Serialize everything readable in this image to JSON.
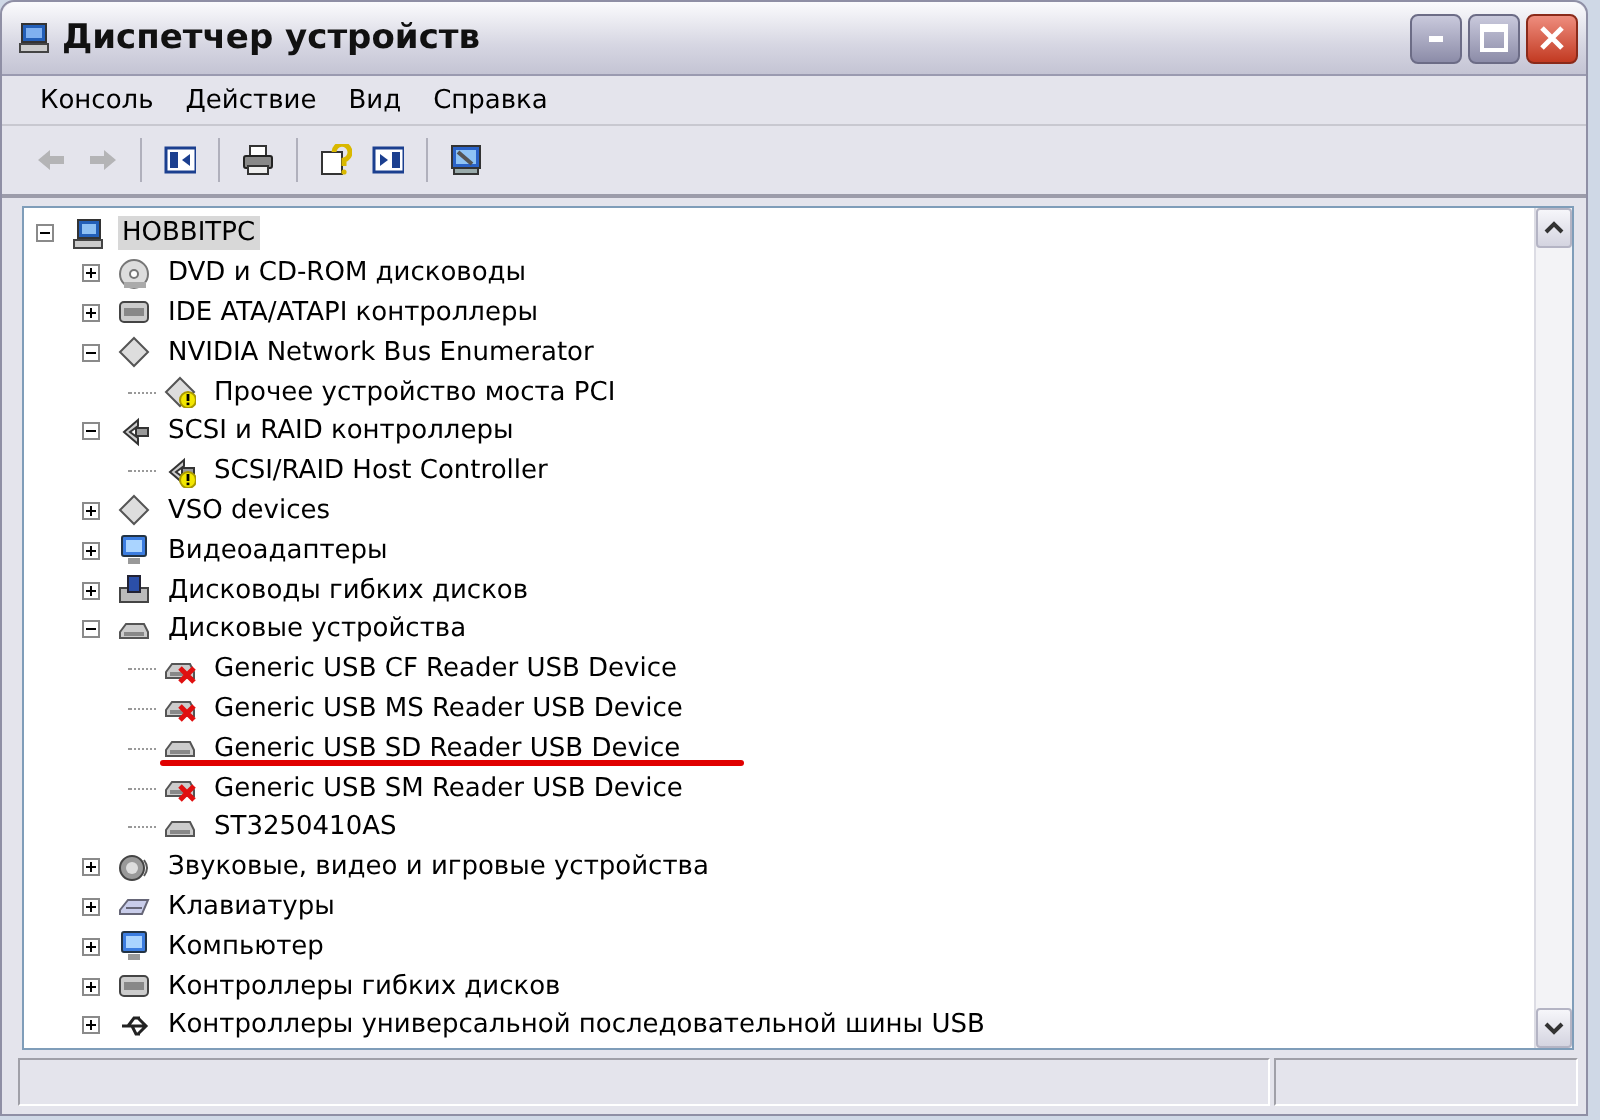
{
  "window": {
    "title": "Диспетчер устройств"
  },
  "menu": [
    "Консоль",
    "Действие",
    "Вид",
    "Справка"
  ],
  "toolbar": [
    [
      {
        "kind": "back",
        "disabled": true
      },
      {
        "kind": "forward",
        "disabled": true
      }
    ],
    [
      {
        "kind": "tree-pane",
        "disabled": false
      }
    ],
    [
      {
        "kind": "print",
        "disabled": false
      }
    ],
    [
      {
        "kind": "help",
        "disabled": false
      },
      {
        "kind": "pane",
        "disabled": false
      }
    ],
    [
      {
        "kind": "properties",
        "disabled": false
      }
    ]
  ],
  "tree": {
    "label": "HOBBITPC",
    "kind": "computer",
    "selected": true,
    "expanded": true,
    "children": [
      {
        "label": "DVD и CD-ROM дисководы",
        "kind": "cdrom",
        "expanded": false
      },
      {
        "label": "IDE ATA/ATAPI контроллеры",
        "kind": "controller",
        "expanded": false
      },
      {
        "label": "NVIDIA Network Bus Enumerator",
        "kind": "generic",
        "expanded": true,
        "children": [
          {
            "label": "Прочее устройство моста PCI",
            "kind": "generic",
            "warning": true,
            "error": false,
            "underlined": false
          }
        ]
      },
      {
        "label": "SCSI и RAID контроллеры",
        "kind": "scsi",
        "expanded": true,
        "children": [
          {
            "label": "SCSI/RAID Host Controller",
            "kind": "scsi",
            "warning": true,
            "error": false,
            "underlined": false
          }
        ]
      },
      {
        "label": "VSO devices",
        "kind": "generic",
        "expanded": false
      },
      {
        "label": "Видеоадаптеры",
        "kind": "display",
        "expanded": false
      },
      {
        "label": "Дисководы гибких дисков",
        "kind": "floppy",
        "expanded": false
      },
      {
        "label": "Дисковые устройства",
        "kind": "disk",
        "expanded": true,
        "children": [
          {
            "label": "Generic USB CF Reader USB Device",
            "kind": "disk",
            "warning": false,
            "error": true,
            "underlined": false
          },
          {
            "label": "Generic USB MS Reader USB Device",
            "kind": "disk",
            "warning": false,
            "error": true,
            "underlined": false
          },
          {
            "label": "Generic USB SD Reader USB Device",
            "kind": "disk",
            "warning": false,
            "error": false,
            "underlined": true
          },
          {
            "label": "Generic USB SM Reader USB Device",
            "kind": "disk",
            "warning": false,
            "error": true,
            "underlined": false
          },
          {
            "label": "ST3250410AS",
            "kind": "disk",
            "warning": false,
            "error": false,
            "underlined": false
          }
        ]
      },
      {
        "label": "Звуковые, видео и игровые устройства",
        "kind": "sound",
        "expanded": false
      },
      {
        "label": "Клавиатуры",
        "kind": "keyboard",
        "expanded": false
      },
      {
        "label": "Компьютер",
        "kind": "display",
        "expanded": false
      },
      {
        "label": "Контроллеры гибких дисков",
        "kind": "controller",
        "expanded": false
      },
      {
        "label": "Контроллеры универсальной последовательной шины USB",
        "kind": "usb",
        "expanded": false
      }
    ]
  }
}
